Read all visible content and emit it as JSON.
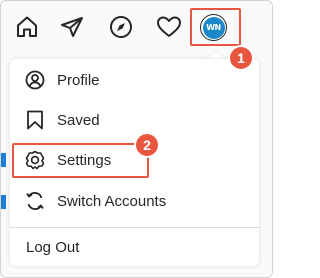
{
  "nav": {
    "icons": [
      "home-icon",
      "direct-message-icon",
      "explore-icon",
      "activity-heart-icon",
      "profile-avatar"
    ],
    "avatar_initials": "WN"
  },
  "callouts": {
    "first": "1",
    "second": "2"
  },
  "menu": {
    "items": [
      {
        "label": "Profile",
        "icon": "profile-circle-icon"
      },
      {
        "label": "Saved",
        "icon": "bookmark-icon"
      },
      {
        "label": "Settings",
        "icon": "settings-gear-icon"
      },
      {
        "label": "Switch Accounts",
        "icon": "switch-accounts-icon"
      }
    ],
    "logout_label": "Log Out"
  },
  "colors": {
    "highlight": "#e8563f",
    "avatar_blue": "#1a88c9",
    "text": "#262626"
  }
}
